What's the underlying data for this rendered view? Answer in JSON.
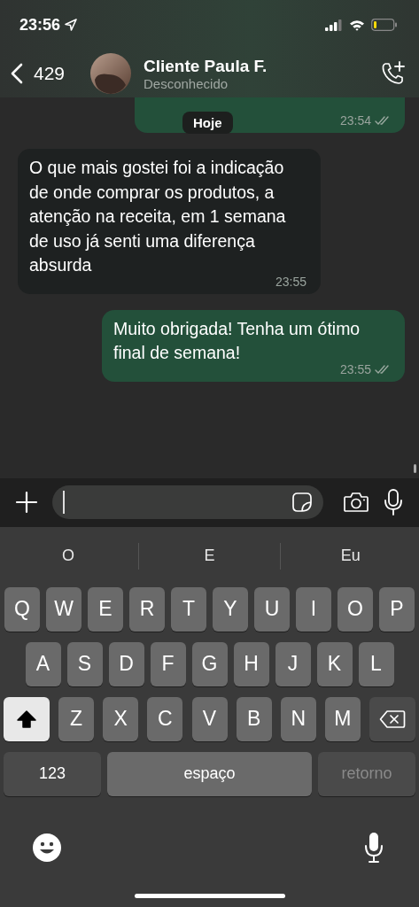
{
  "status_bar": {
    "time": "23:56",
    "location_on": true,
    "battery_low": true
  },
  "header": {
    "back_count": "429",
    "name": "Cliente Paula F.",
    "status": "Desconhecido"
  },
  "date_chip": "Hoje",
  "messages": [
    {
      "kind": "outgoing",
      "time": "23:54",
      "read": true
    },
    {
      "kind": "incoming",
      "text": "O que mais gostei foi a indicação de onde comprar os produtos, a atenção na receita, em 1 semana de uso já senti uma diferença absurda",
      "time": "23:55"
    },
    {
      "kind": "outgoing",
      "text": "Muito obrigada! Tenha um ótimo final de semana!",
      "time": "23:55",
      "read": true
    }
  ],
  "suggestions": [
    "O",
    "E",
    "Eu"
  ],
  "keyboard": [
    [
      {
        "kind": "letter",
        "label": "Q"
      },
      {
        "kind": "letter",
        "label": "W"
      },
      {
        "kind": "letter",
        "label": "E"
      },
      {
        "kind": "letter",
        "label": "R"
      },
      {
        "kind": "letter",
        "label": "T"
      },
      {
        "kind": "letter",
        "label": "Y"
      },
      {
        "kind": "letter",
        "label": "U"
      },
      {
        "kind": "letter",
        "label": "I"
      },
      {
        "kind": "letter",
        "label": "O"
      },
      {
        "kind": "letter",
        "label": "P"
      }
    ],
    [
      {
        "kind": "letter",
        "label": "A"
      },
      {
        "kind": "letter",
        "label": "S"
      },
      {
        "kind": "letter",
        "label": "D"
      },
      {
        "kind": "letter",
        "label": "F"
      },
      {
        "kind": "letter",
        "label": "G"
      },
      {
        "kind": "letter",
        "label": "H"
      },
      {
        "kind": "letter",
        "label": "J"
      },
      {
        "kind": "letter",
        "label": "K"
      },
      {
        "kind": "letter",
        "label": "L"
      }
    ],
    [
      {
        "kind": "shift",
        "on": true
      },
      {
        "kind": "letter",
        "label": "Z"
      },
      {
        "kind": "letter",
        "label": "X"
      },
      {
        "kind": "letter",
        "label": "C"
      },
      {
        "kind": "letter",
        "label": "V"
      },
      {
        "kind": "letter",
        "label": "B"
      },
      {
        "kind": "letter",
        "label": "N"
      },
      {
        "kind": "letter",
        "label": "M"
      },
      {
        "kind": "backspace"
      }
    ],
    [
      {
        "kind": "numbers",
        "label": "123"
      },
      {
        "kind": "space",
        "label": "espaço"
      },
      {
        "kind": "return",
        "label": "retorno",
        "disabled": true
      }
    ]
  ]
}
